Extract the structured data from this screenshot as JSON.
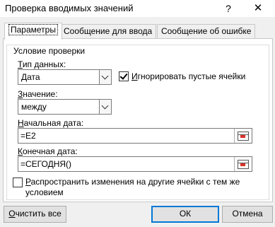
{
  "dialog": {
    "title": "Проверка вводимых значений",
    "help_icon": "?",
    "close_icon": "✕"
  },
  "tabs": [
    {
      "label": "Параметры",
      "active": true
    },
    {
      "label": "Сообщение для ввода"
    },
    {
      "label": "Сообщение об ошибке"
    }
  ],
  "criteria": {
    "group_title": "Условие проверки",
    "allow": {
      "label_u": "Т",
      "label_rest": "ип данных:",
      "value": "Дата"
    },
    "ignore_blank": {
      "label_u": "И",
      "label_rest": "гнорировать пустые ячейки",
      "checked": true
    },
    "data": {
      "label_u": "З",
      "label_rest": "начение:",
      "value": "между"
    },
    "start_date": {
      "label_u": "Н",
      "label_rest": "ачальная дата:",
      "value": "=E2"
    },
    "end_date": {
      "label_u": "К",
      "label_rest": "онечная дата:",
      "value": "=СЕГОДНЯ()"
    }
  },
  "apply_all": {
    "label_u": "Р",
    "label_rest": "аспространить изменения на другие ячейки с тем же",
    "label_line2": "условием",
    "checked": false
  },
  "buttons": {
    "clear_u": "О",
    "clear_rest": "чистить все",
    "ok": "ОК",
    "cancel": "Отмена"
  },
  "colors": {
    "accent": "#0078d7",
    "dialog_bg": "#f0f0f0"
  }
}
